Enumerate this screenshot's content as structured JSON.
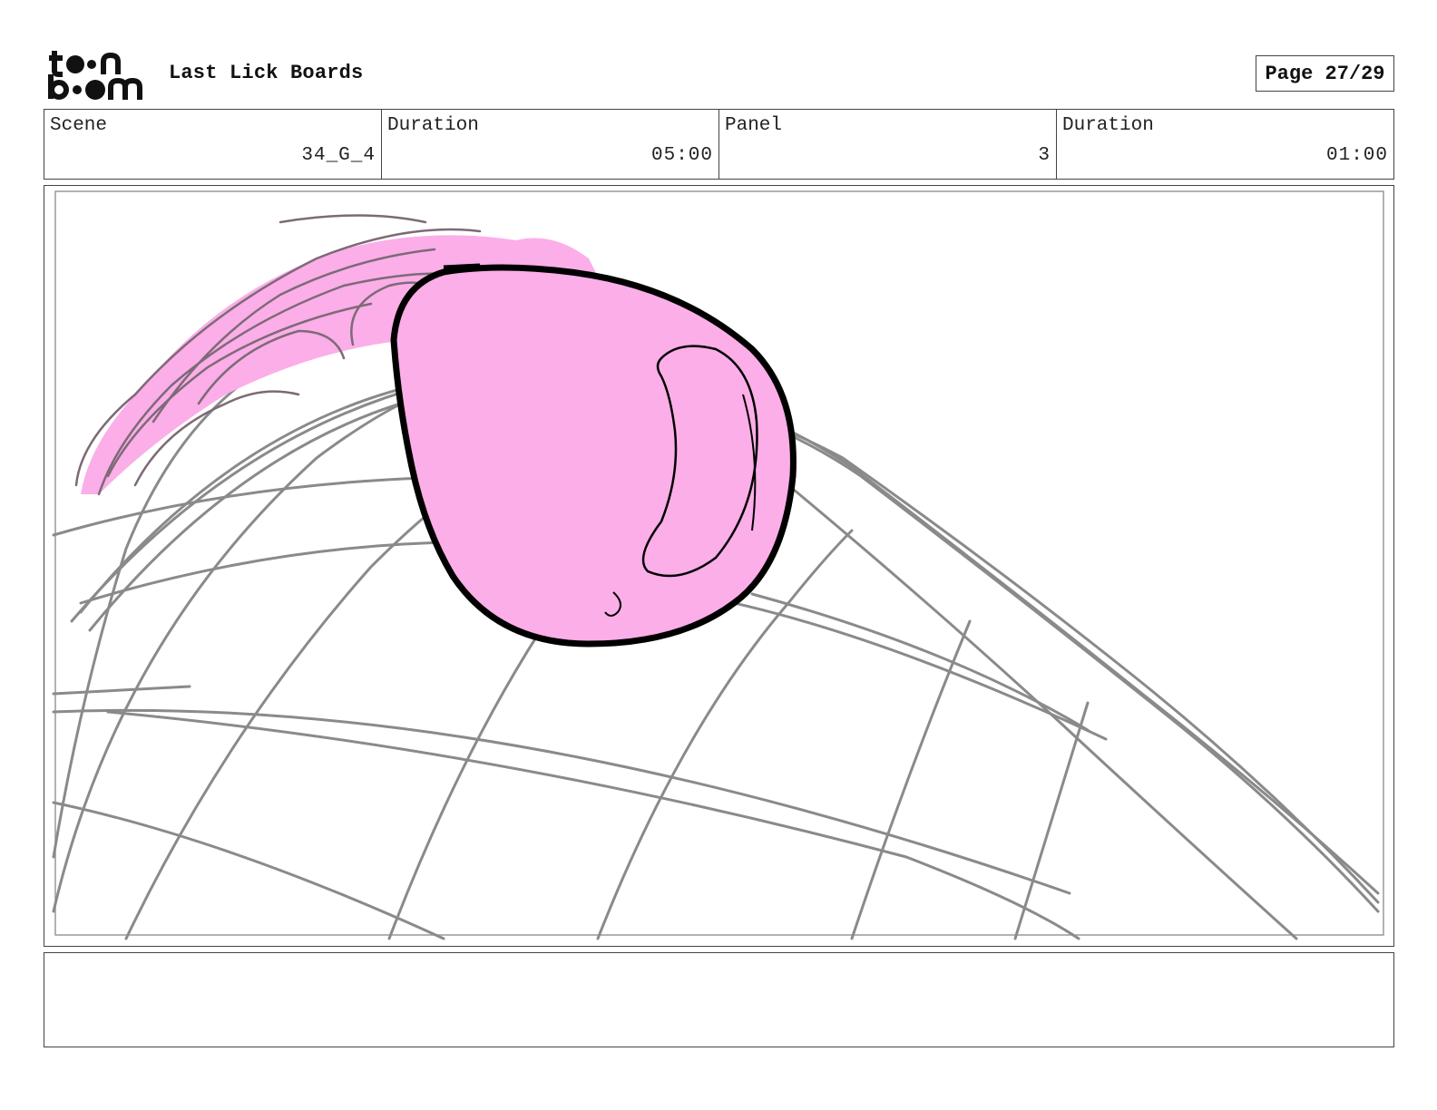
{
  "header": {
    "logo_text": "toon boom",
    "project_title": "Last Lick Boards",
    "page_indicator": "Page 27/29"
  },
  "info_row": [
    {
      "label": "Scene",
      "value": "34_G_4"
    },
    {
      "label": "Duration",
      "value": "05:00"
    },
    {
      "label": "Panel",
      "value": "3"
    },
    {
      "label": "Duration",
      "value": "01:00"
    }
  ],
  "panel": {
    "description": "",
    "colors": {
      "sketch_lines": "#8a8a8a",
      "character_fill": "#fbaee8",
      "ink": "#000000",
      "safe_frame": "#999999"
    }
  },
  "notes": {
    "text": ""
  }
}
